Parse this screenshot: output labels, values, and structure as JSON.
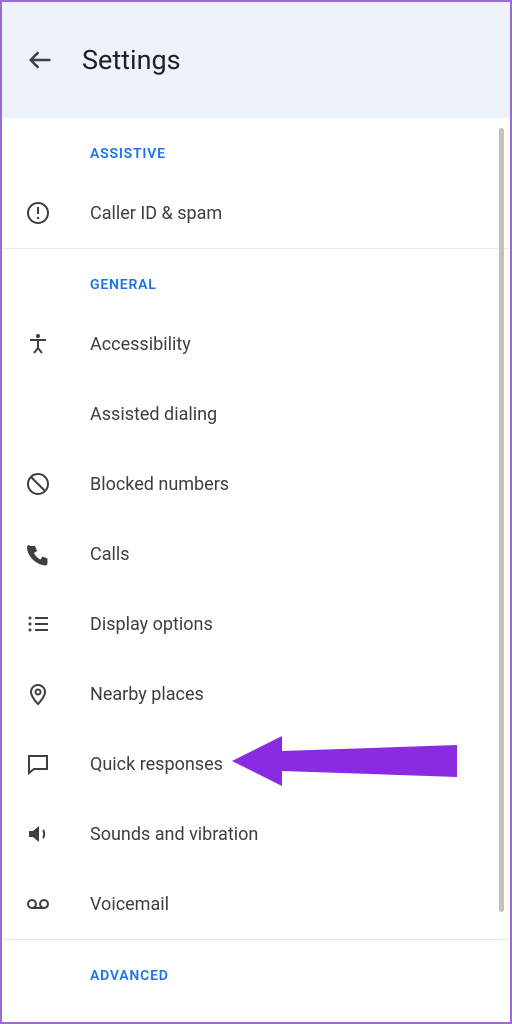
{
  "header": {
    "title": "Settings"
  },
  "sections": {
    "assistive": {
      "label": "ASSISTIVE",
      "items": {
        "caller_id": "Caller ID & spam"
      }
    },
    "general": {
      "label": "GENERAL",
      "items": {
        "accessibility": "Accessibility",
        "assisted_dialing": "Assisted dialing",
        "blocked_numbers": "Blocked numbers",
        "calls": "Calls",
        "display_options": "Display options",
        "nearby_places": "Nearby places",
        "quick_responses": "Quick responses",
        "sounds_vibration": "Sounds and vibration",
        "voicemail": "Voicemail"
      }
    },
    "advanced": {
      "label": "ADVANCED"
    }
  },
  "annotation": {
    "color": "#8a2be2"
  }
}
